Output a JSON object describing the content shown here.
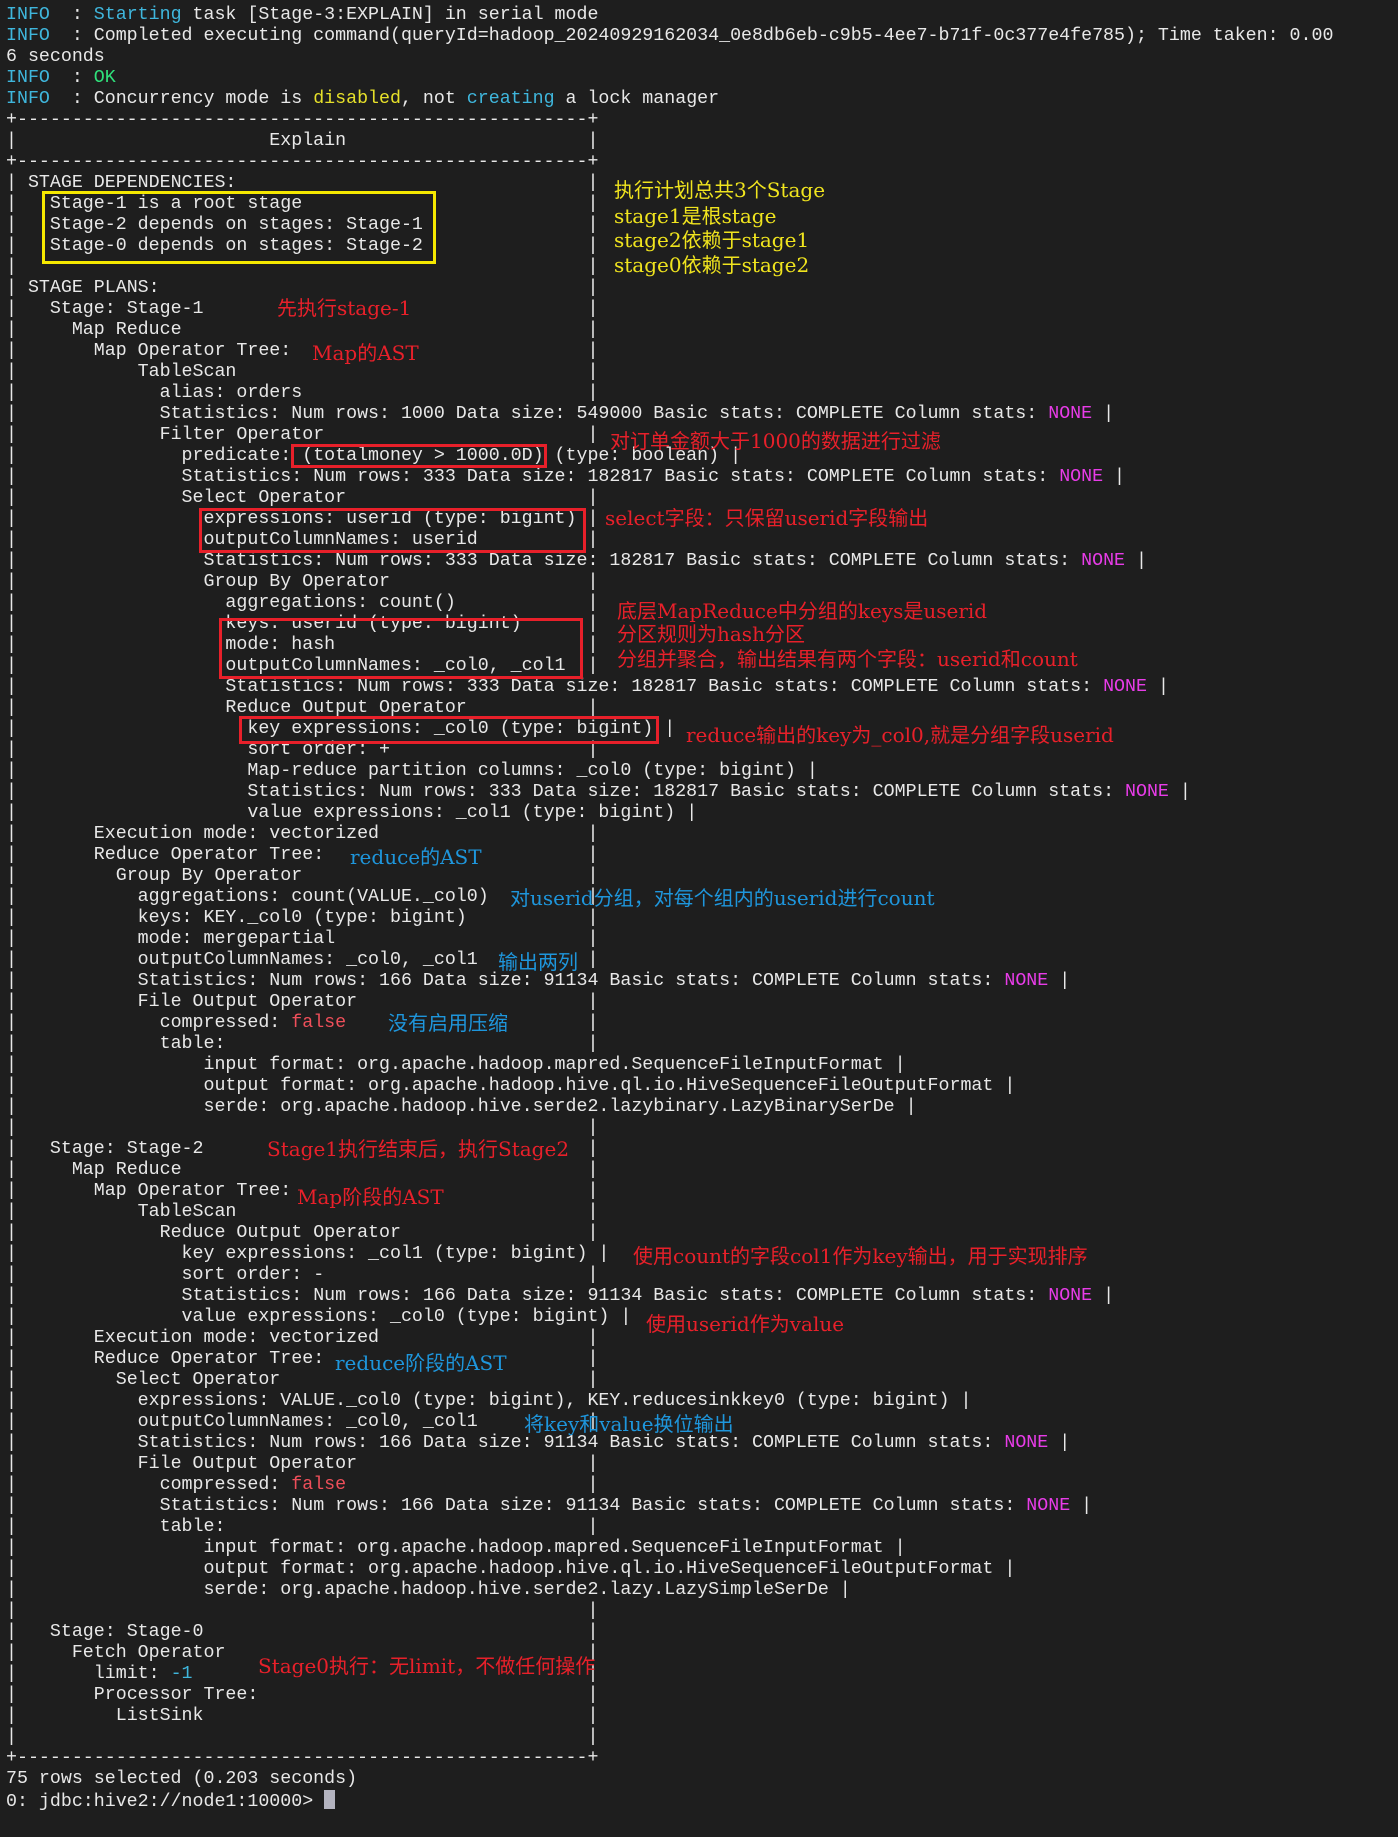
{
  "colors": {
    "info": "#3fb6dc",
    "ok": "#2fe07a",
    "yellow": "#e6e02a",
    "magenta": "#e83ce8",
    "false": "#ef4f5a",
    "cyan": "#3fb6dc",
    "text": "#e8e8e8"
  },
  "terminal": {
    "pre": [
      [
        [
          "INFO",
          "info"
        ],
        [
          "  : "
        ],
        [
          "Starting",
          "info"
        ],
        [
          " task [Stage-3:EXPLAIN] in serial mode"
        ]
      ],
      [
        [
          "INFO",
          "info"
        ],
        [
          "  : Completed executing command(queryId=hadoop_20240929162034_0e8db6eb-c9b5-4ee7-b71f-0c377e4fe785); Time taken: 0.00"
        ]
      ],
      [
        [
          "6 seconds"
        ]
      ],
      [
        [
          "INFO",
          "info"
        ],
        [
          "  : "
        ],
        [
          "OK",
          "ok"
        ]
      ],
      [
        [
          "INFO",
          "info"
        ],
        [
          "  : Concurrency mode is "
        ],
        [
          "disabled",
          "yellow"
        ],
        [
          ", not "
        ],
        [
          "creating",
          "cyan"
        ],
        [
          " a lock manager"
        ]
      ]
    ],
    "box_header": "Explain",
    "box_lines": [
      " STAGE DEPENDENCIES:",
      "   Stage-1 is a root stage",
      "   Stage-2 depends on stages: Stage-1",
      "   Stage-0 depends on stages: Stage-2",
      "",
      " STAGE PLANS:",
      "   Stage: Stage-1",
      "     Map Reduce",
      "       Map Operator Tree:",
      "           TableScan",
      "             alias: orders",
      [
        [
          "             Statistics: Num rows: 1000 Data size: 549000 Basic stats: COMPLETE Column stats: "
        ],
        [
          "NONE",
          "magenta"
        ]
      ],
      "             Filter Operator",
      "               predicate: (totalmoney > 1000.0D) (type: boolean)",
      [
        [
          "               Statistics: Num rows: 333 Data size: 182817 Basic stats: COMPLETE Column stats: "
        ],
        [
          "NONE",
          "magenta"
        ]
      ],
      "               Select Operator",
      "                 expressions: userid (type: bigint)",
      "                 outputColumnNames: userid",
      [
        [
          "                 Statistics: Num rows: 333 Data size: 182817 Basic stats: COMPLETE Column stats: "
        ],
        [
          "NONE",
          "magenta"
        ]
      ],
      "                 Group By Operator",
      "                   aggregations: count()",
      "                   keys: userid (type: bigint)",
      "                   mode: hash",
      "                   outputColumnNames: _col0, _col1",
      [
        [
          "                   Statistics: Num rows: 333 Data size: 182817 Basic stats: COMPLETE Column stats: "
        ],
        [
          "NONE",
          "magenta"
        ]
      ],
      "                   Reduce Output Operator",
      "                     key expressions: _col0 (type: bigint)",
      "                     sort order: +",
      "                     Map-reduce partition columns: _col0 (type: bigint)",
      [
        [
          "                     Statistics: Num rows: 333 Data size: 182817 Basic stats: COMPLETE Column stats: "
        ],
        [
          "NONE",
          "magenta"
        ]
      ],
      "                     value expressions: _col1 (type: bigint)",
      "       Execution mode: vectorized",
      "       Reduce Operator Tree:",
      "         Group By Operator",
      "           aggregations: count(VALUE._col0)",
      "           keys: KEY._col0 (type: bigint)",
      "           mode: mergepartial",
      "           outputColumnNames: _col0, _col1",
      [
        [
          "           Statistics: Num rows: 166 Data size: 91134 Basic stats: COMPLETE Column stats: "
        ],
        [
          "NONE",
          "magenta"
        ]
      ],
      "           File Output Operator",
      [
        [
          "             compressed: "
        ],
        [
          "false",
          "false"
        ]
      ],
      "             table:",
      "                 input format: org.apache.hadoop.mapred.SequenceFileInputFormat",
      "                 output format: org.apache.hadoop.hive.ql.io.HiveSequenceFileOutputFormat",
      "                 serde: org.apache.hadoop.hive.serde2.lazybinary.LazyBinarySerDe",
      "",
      "   Stage: Stage-2",
      "     Map Reduce",
      "       Map Operator Tree:",
      "           TableScan",
      "             Reduce Output Operator",
      "               key expressions: _col1 (type: bigint)",
      "               sort order: -",
      [
        [
          "               Statistics: Num rows: 166 Data size: 91134 Basic stats: COMPLETE Column stats: "
        ],
        [
          "NONE",
          "magenta"
        ]
      ],
      "               value expressions: _col0 (type: bigint)",
      "       Execution mode: vectorized",
      "       Reduce Operator Tree:",
      "         Select Operator",
      "           expressions: VALUE._col0 (type: bigint), KEY.reducesinkkey0 (type: bigint)",
      "           outputColumnNames: _col0, _col1",
      [
        [
          "           Statistics: Num rows: 166 Data size: 91134 Basic stats: COMPLETE Column stats: "
        ],
        [
          "NONE",
          "magenta"
        ]
      ],
      "           File Output Operator",
      [
        [
          "             compressed: "
        ],
        [
          "false",
          "false"
        ]
      ],
      [
        [
          "             Statistics: Num rows: 166 Data size: 91134 Basic stats: COMPLETE Column stats: "
        ],
        [
          "NONE",
          "magenta"
        ]
      ],
      "             table:",
      "                 input format: org.apache.hadoop.mapred.SequenceFileInputFormat",
      "                 output format: org.apache.hadoop.hive.ql.io.HiveSequenceFileOutputFormat",
      "                 serde: org.apache.hadoop.hive.serde2.lazy.LazySimpleSerDe",
      "",
      "   Stage: Stage-0",
      "     Fetch Operator",
      [
        [
          "       limit: "
        ],
        [
          "-1",
          "cyan"
        ]
      ],
      "       Processor Tree:",
      "         ListSink",
      ""
    ],
    "rows_selected": "75 rows selected (0.203 seconds)",
    "prompt": "0: jdbc:hive2://node1:10000> "
  },
  "annotations": {
    "deps_1": "执行计划总共3个Stage",
    "deps_2": "stage1是根stage",
    "deps_3": "stage2依赖于stage1",
    "deps_4": "stage0依赖于stage2",
    "stage1_first": "先执行stage-1",
    "map_ast": "Map的AST",
    "filter": "对订单金额大于1000的数据进行过滤",
    "select": "select字段：只保留userid字段输出",
    "group_keys": "底层MapReduce中分组的keys是userid",
    "partition": "分区规则为hash分区",
    "group_agg": "分组并聚合，输出结果有两个字段：userid和count",
    "reduce_key": "reduce输出的key为_col0,就是分组字段userid",
    "reduce_ast": "reduce的AST",
    "group_count": "对userid分组，对每个组内的userid进行count",
    "two_cols": "输出两列",
    "no_compress": "没有启用压缩",
    "stage2_after": "Stage1执行结束后，执行Stage2",
    "map_stage_ast": "Map阶段的AST",
    "sort_key": "使用count的字段col1作为key输出，用于实现排序",
    "value_userid": "使用userid作为value",
    "reduce_stage_ast": "reduce阶段的AST",
    "swap": "将key和value换位输出",
    "stage0": "Stage0执行：无limit，不做任何操作"
  }
}
